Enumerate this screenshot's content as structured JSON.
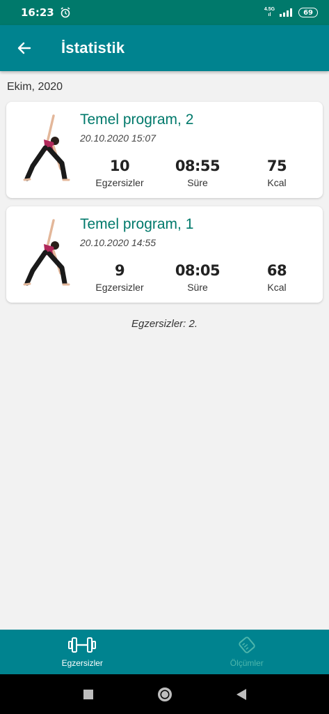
{
  "status_bar": {
    "time": "16:23",
    "network_top": "4.5G",
    "network_bottom": "ıl",
    "battery": "69"
  },
  "app_bar": {
    "title": "İstatistik",
    "back_icon": "back-arrow-icon"
  },
  "month": "Ekim, 2020",
  "sessions": [
    {
      "title": "Temel program, 2",
      "datetime": "20.10.2020 15:07",
      "exercises": "10",
      "exercises_label": "Egzersizler",
      "duration": "08:55",
      "duration_label": "Süre",
      "kcal": "75",
      "kcal_label": "Kcal"
    },
    {
      "title": "Temel program, 1",
      "datetime": "20.10.2020 14:55",
      "exercises": "9",
      "exercises_label": "Egzersizler",
      "duration": "08:05",
      "duration_label": "Süre",
      "kcal": "68",
      "kcal_label": "Kcal"
    }
  ],
  "summary": "Egzersizler: 2.",
  "bottom_nav": {
    "items": [
      {
        "label": "Egzersizler",
        "icon": "dumbbell-icon",
        "active": true
      },
      {
        "label": "Ölçümler",
        "icon": "tape-measure-icon",
        "active": false
      }
    ]
  },
  "colors": {
    "primary": "#00838f",
    "primary_dark": "#00796b",
    "accent_text": "#00796b",
    "inactive_nav": "#4db6ac"
  }
}
